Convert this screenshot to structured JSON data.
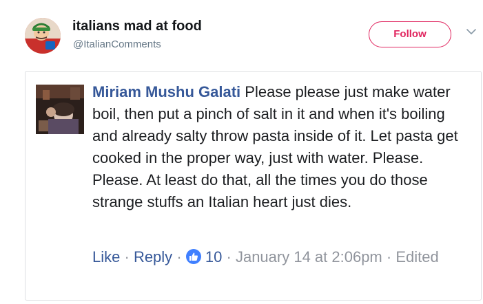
{
  "tweet": {
    "author_name": "italians mad at food",
    "author_handle": "@ItalianComments",
    "follow_label": "Follow",
    "menu_icon": "chevron-down-icon"
  },
  "comment": {
    "commenter_name": "Miriam Mushu Galati",
    "text": "Please please just make water boil, then put a pinch of salt in it and when it's boiling and already salty throw pasta inside of it. Let pasta get cooked in the proper way, just with water. Please. Please. At least do that, all the times you do those strange stuffs an Italian heart just dies.",
    "like_label": "Like",
    "reply_label": "Reply",
    "like_count": "10",
    "timestamp": "January 14 at 2:06pm",
    "edited_label": "Edited",
    "separator": "·",
    "reaction_icon": "thumbs-up-icon"
  },
  "colors": {
    "link_blue": "#365899",
    "follow_red": "#e0245e",
    "meta_gray": "#90949c",
    "like_badge": "#4080ff"
  }
}
